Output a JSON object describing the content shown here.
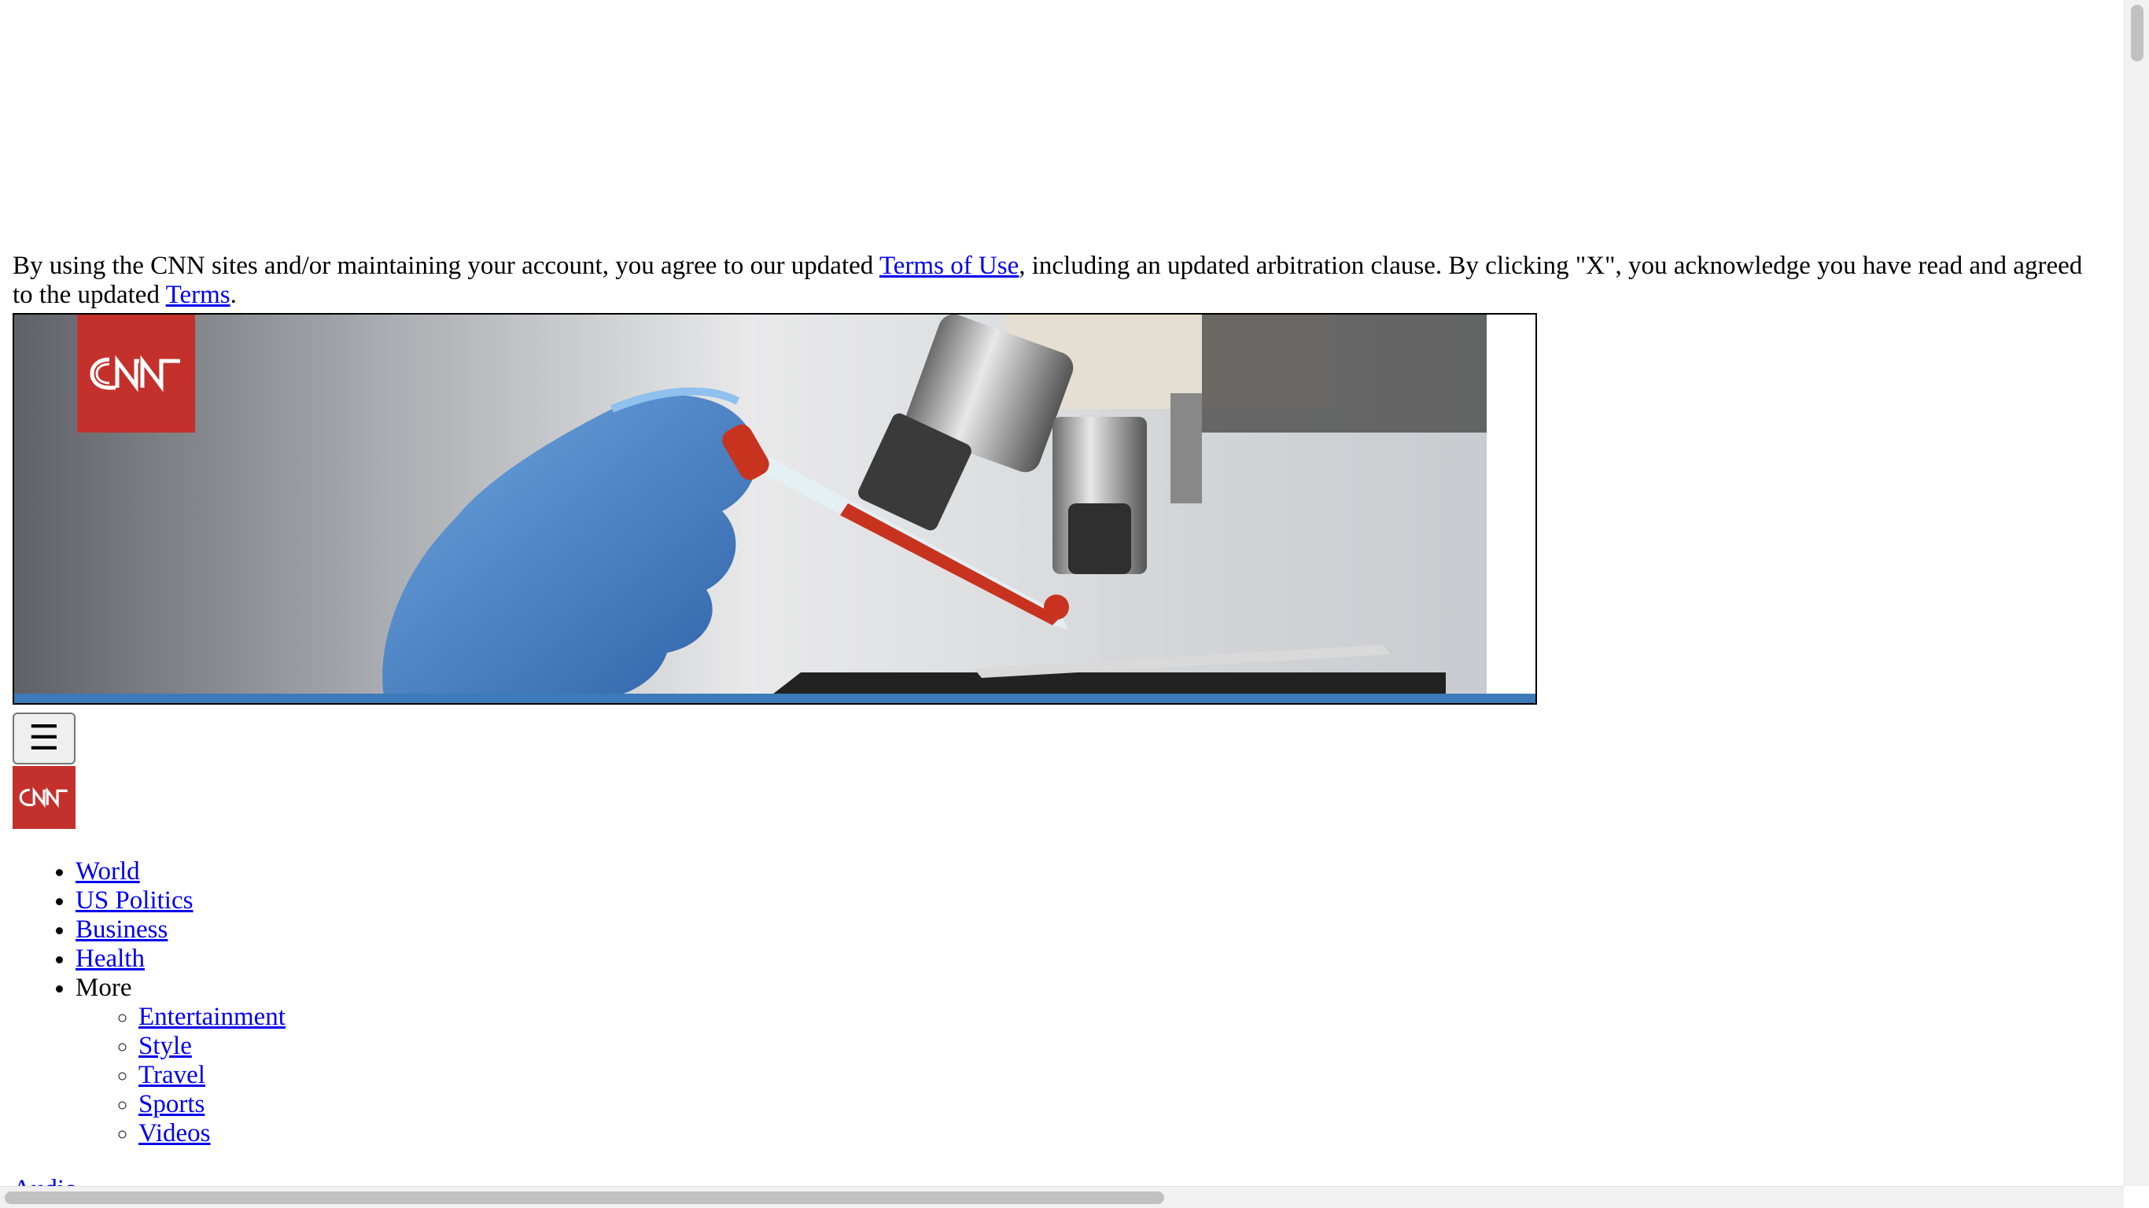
{
  "notice": {
    "text_before": "By using the CNN sites and/or maintaining your account, you agree to our updated ",
    "terms_of_use_link": "Terms of Use",
    "text_middle": ", including an updated arbitration clause. By clicking \"X\", you acknowledge you have read and agreed to the updated ",
    "terms_link": "Terms",
    "text_after": "."
  },
  "banner": {
    "logo_text": "CNN",
    "logo_color": "#c4302b",
    "bar_color": "#3d7ab8"
  },
  "header": {
    "menu_icon": "hamburger-icon",
    "menu_glyph": "☰",
    "logo_text": "CNN"
  },
  "nav": {
    "items": [
      {
        "label": "World"
      },
      {
        "label": "US Politics"
      },
      {
        "label": "Business"
      },
      {
        "label": "Health"
      }
    ],
    "more_label": "More",
    "more_items": [
      {
        "label": "Entertainment"
      },
      {
        "label": "Style"
      },
      {
        "label": "Travel"
      },
      {
        "label": "Sports"
      },
      {
        "label": "Videos"
      }
    ]
  },
  "cut_off_link": "Audio"
}
